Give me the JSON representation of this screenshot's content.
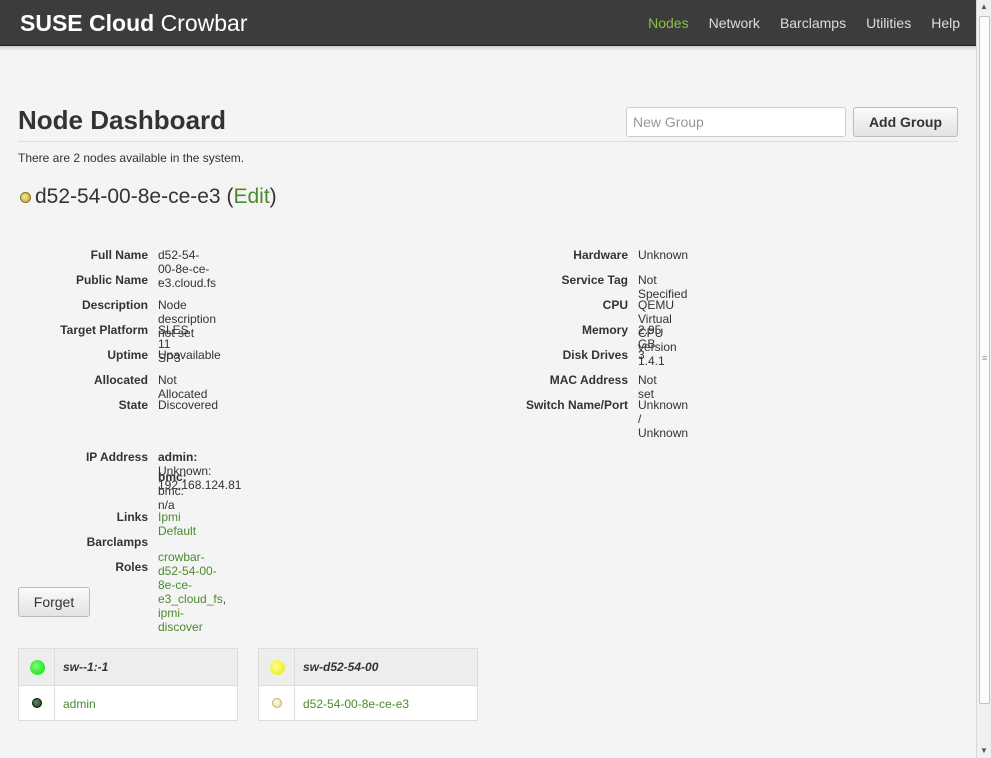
{
  "header": {
    "brand_bold": "SUSE Cloud",
    "brand_light": "Crowbar",
    "nav": [
      "Nodes",
      "Network",
      "Barclamps",
      "Utilities",
      "Help"
    ],
    "active_nav": "Nodes",
    "active_color": "#8ac13f"
  },
  "page": {
    "title": "Node Dashboard",
    "new_group_placeholder": "New Group",
    "add_group_label": "Add Group",
    "summary": "There are 2 nodes available in the system."
  },
  "node": {
    "name": "d52-54-00-8e-ce-e3",
    "edit_open": "(",
    "edit_label": "Edit",
    "edit_close": ")",
    "left_fields": [
      {
        "label": "Full Name",
        "value": "d52-54-00-8e-ce-e3.cloud.fs"
      },
      {
        "label": "Public Name",
        "value": "-"
      },
      {
        "label": "Description",
        "value": "Node description not set"
      },
      {
        "label": "Target Platform",
        "value": "SLES 11 SP3"
      },
      {
        "label": "Uptime",
        "value": "Unavailable"
      },
      {
        "label": "Allocated",
        "value": "Not Allocated"
      },
      {
        "label": "State",
        "value": "Discovered"
      }
    ],
    "right_fields": [
      {
        "label": "Hardware",
        "value": "Unknown"
      },
      {
        "label": "Service Tag",
        "value": "Not Specified"
      },
      {
        "label": "CPU",
        "value": "QEMU Virtual CPU version 1.4.1"
      },
      {
        "label": "Memory",
        "value": "2.95 GB"
      },
      {
        "label": "Disk Drives",
        "value": "3"
      },
      {
        "label": "MAC Address",
        "value": "Not set"
      },
      {
        "label": "Switch Name/Port",
        "value": "Unknown / Unknown"
      }
    ],
    "ip_label": "IP Address",
    "ip_admin_key": "admin:",
    "ip_admin_value": "Unknown: 192.168.124.81",
    "ip_bmc_key": "bmc:",
    "ip_bmc_value": "bmc: n/a",
    "links_label": "Links",
    "links_value": "Ipmi Default",
    "barclamps_label": "Barclamps",
    "roles_label": "Roles",
    "role_1": "crowbar-d52-54-00-8e-ce-e3_cloud_fs",
    "role_sep": ",",
    "role_2": "ipmi-discover",
    "forget_label": "Forget"
  },
  "switches": [
    {
      "name": "sw--1:-1",
      "status_color": "#00ee00",
      "node": "admin",
      "node_status": "ready"
    },
    {
      "name": "sw-d52-54-00",
      "status_color": "#f0f000",
      "node": "d52-54-00-8e-ce-e3",
      "node_status": "discovered"
    }
  ]
}
